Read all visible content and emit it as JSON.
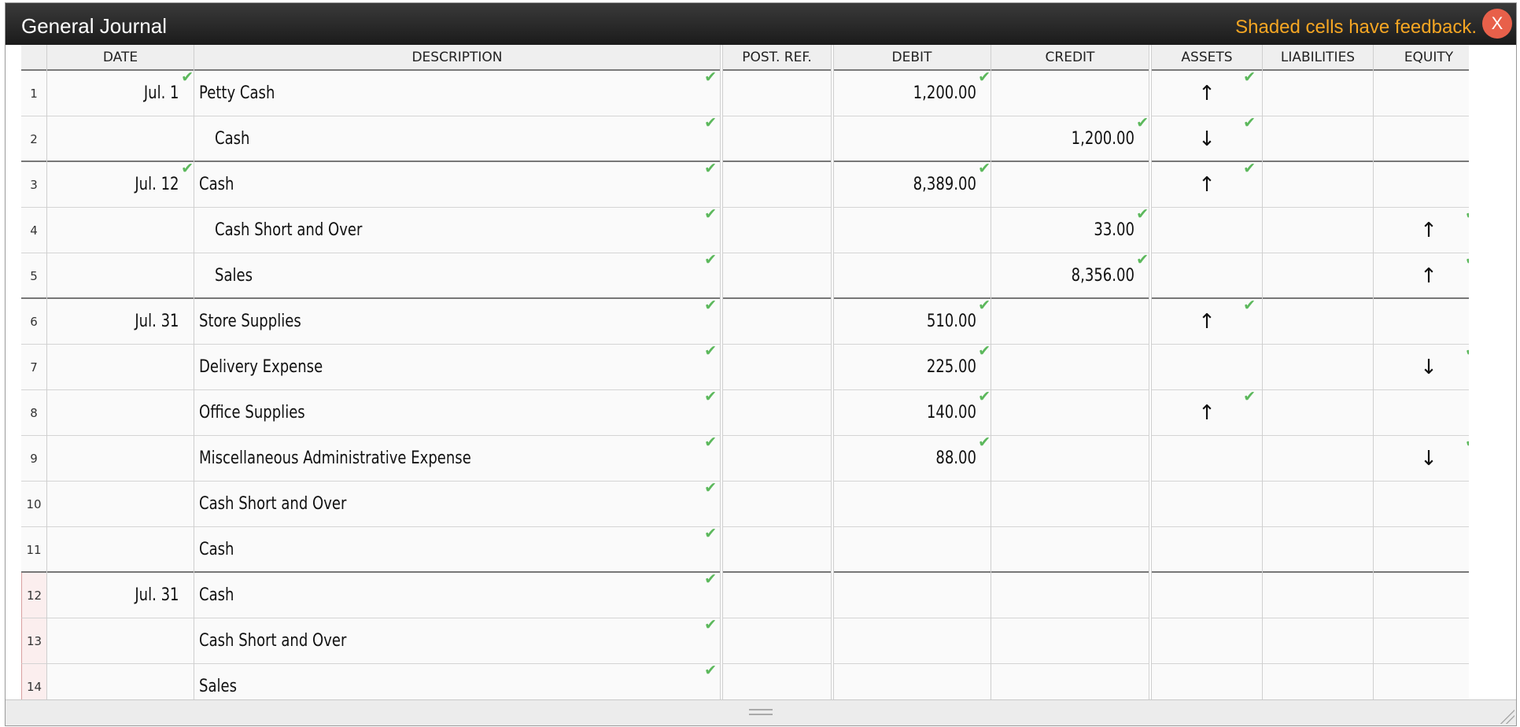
{
  "window": {
    "title": "General Journal",
    "feedback": "Shaded cells have feedback.",
    "close_label": "X"
  },
  "columns": [
    "DATE",
    "DESCRIPTION",
    "POST. REF.",
    "DEBIT",
    "CREDIT",
    "ASSETS",
    "LIABILITIES",
    "EQUITY"
  ],
  "arrow_symbols": {
    "up": "↑",
    "down": "↓"
  },
  "check_symbol": "✔",
  "colors": {
    "accent_feedback": "#f5a623",
    "check": "#5cb85c",
    "close": "#e8604a",
    "feedback_row": "#fbeeee"
  },
  "rows": [
    {
      "num": "1",
      "date": "Jul. 1",
      "date_check": true,
      "desc": "Petty Cash",
      "indent": false,
      "desc_check": true,
      "debit": "1,200.00",
      "debit_check": true,
      "credit": "",
      "credit_check": false,
      "assets": "up",
      "assets_check": true,
      "liabilities": "",
      "equity": "",
      "equity_check": false,
      "sep": false,
      "feedback": false
    },
    {
      "num": "2",
      "date": "",
      "date_check": false,
      "desc": "Cash",
      "indent": true,
      "desc_check": true,
      "debit": "",
      "debit_check": false,
      "credit": "1,200.00",
      "credit_check": true,
      "assets": "down",
      "assets_check": true,
      "liabilities": "",
      "equity": "",
      "equity_check": false,
      "sep": true,
      "feedback": false
    },
    {
      "num": "3",
      "date": "Jul. 12",
      "date_check": true,
      "desc": "Cash",
      "indent": false,
      "desc_check": true,
      "debit": "8,389.00",
      "debit_check": true,
      "credit": "",
      "credit_check": false,
      "assets": "up",
      "assets_check": true,
      "liabilities": "",
      "equity": "",
      "equity_check": false,
      "sep": false,
      "feedback": false
    },
    {
      "num": "4",
      "date": "",
      "date_check": false,
      "desc": "Cash Short and Over",
      "indent": true,
      "desc_check": true,
      "debit": "",
      "debit_check": false,
      "credit": "33.00",
      "credit_check": true,
      "assets": "",
      "assets_check": false,
      "liabilities": "",
      "equity": "up",
      "equity_check": true,
      "sep": false,
      "feedback": false
    },
    {
      "num": "5",
      "date": "",
      "date_check": false,
      "desc": "Sales",
      "indent": true,
      "desc_check": true,
      "debit": "",
      "debit_check": false,
      "credit": "8,356.00",
      "credit_check": true,
      "assets": "",
      "assets_check": false,
      "liabilities": "",
      "equity": "up",
      "equity_check": true,
      "sep": true,
      "feedback": false
    },
    {
      "num": "6",
      "date": "Jul. 31",
      "date_check": false,
      "desc": "Store Supplies",
      "indent": false,
      "desc_check": true,
      "debit": "510.00",
      "debit_check": true,
      "credit": "",
      "credit_check": false,
      "assets": "up",
      "assets_check": true,
      "liabilities": "",
      "equity": "",
      "equity_check": false,
      "sep": false,
      "feedback": false
    },
    {
      "num": "7",
      "date": "",
      "date_check": false,
      "desc": "Delivery Expense",
      "indent": false,
      "desc_check": true,
      "debit": "225.00",
      "debit_check": true,
      "credit": "",
      "credit_check": false,
      "assets": "",
      "assets_check": false,
      "liabilities": "",
      "equity": "down",
      "equity_check": true,
      "sep": false,
      "feedback": false
    },
    {
      "num": "8",
      "date": "",
      "date_check": false,
      "desc": "Office Supplies",
      "indent": false,
      "desc_check": true,
      "debit": "140.00",
      "debit_check": true,
      "credit": "",
      "credit_check": false,
      "assets": "up",
      "assets_check": true,
      "liabilities": "",
      "equity": "",
      "equity_check": false,
      "sep": false,
      "feedback": false
    },
    {
      "num": "9",
      "date": "",
      "date_check": false,
      "desc": "Miscellaneous Administrative Expense",
      "indent": false,
      "desc_check": true,
      "debit": "88.00",
      "debit_check": true,
      "credit": "",
      "credit_check": false,
      "assets": "",
      "assets_check": false,
      "liabilities": "",
      "equity": "down",
      "equity_check": true,
      "sep": false,
      "feedback": false
    },
    {
      "num": "10",
      "date": "",
      "date_check": false,
      "desc": "Cash Short and Over",
      "indent": false,
      "desc_check": true,
      "debit": "",
      "debit_check": false,
      "credit": "",
      "credit_check": false,
      "assets": "",
      "assets_check": false,
      "liabilities": "",
      "equity": "",
      "equity_check": false,
      "sep": false,
      "feedback": false
    },
    {
      "num": "11",
      "date": "",
      "date_check": false,
      "desc": "Cash",
      "indent": false,
      "desc_check": true,
      "debit": "",
      "debit_check": false,
      "credit": "",
      "credit_check": false,
      "assets": "",
      "assets_check": false,
      "liabilities": "",
      "equity": "",
      "equity_check": false,
      "sep": true,
      "feedback": false
    },
    {
      "num": "12",
      "date": "Jul. 31",
      "date_check": false,
      "desc": "Cash",
      "indent": false,
      "desc_check": true,
      "debit": "",
      "debit_check": false,
      "credit": "",
      "credit_check": false,
      "assets": "",
      "assets_check": false,
      "liabilities": "",
      "equity": "",
      "equity_check": false,
      "sep": false,
      "feedback": true
    },
    {
      "num": "13",
      "date": "",
      "date_check": false,
      "desc": "Cash Short and Over",
      "indent": false,
      "desc_check": true,
      "debit": "",
      "debit_check": false,
      "credit": "",
      "credit_check": false,
      "assets": "",
      "assets_check": false,
      "liabilities": "",
      "equity": "",
      "equity_check": false,
      "sep": false,
      "feedback": true
    },
    {
      "num": "14",
      "date": "",
      "date_check": false,
      "desc": "Sales",
      "indent": false,
      "desc_check": true,
      "debit": "",
      "debit_check": false,
      "credit": "",
      "credit_check": false,
      "assets": "",
      "assets_check": false,
      "liabilities": "",
      "equity": "",
      "equity_check": false,
      "sep": false,
      "feedback": true
    }
  ]
}
